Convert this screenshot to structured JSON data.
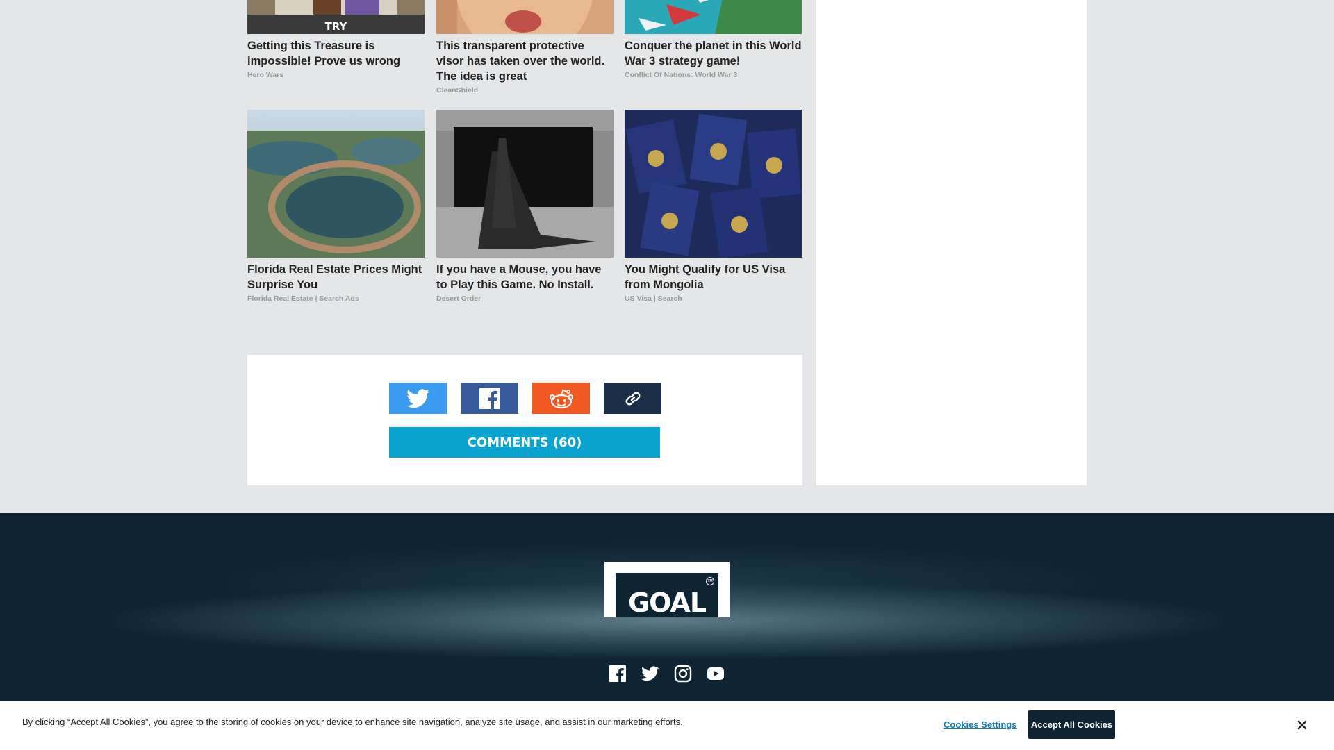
{
  "ads": [
    {
      "title": "Getting this Treasure is impossible! Prove us wrong",
      "source": "Hero Wars",
      "image": "game-castle-image",
      "badge": "TRY"
    },
    {
      "title": "This transparent protective visor has taken over the world. The idea is great",
      "source": "CleanShield",
      "image": "face-visor-image"
    },
    {
      "title": "Conquer the planet in this World War 3 strategy game!",
      "source": "Conflict Of Nations: World War 3",
      "image": "war-map-image"
    },
    {
      "title": "Florida Real Estate Prices Might Surprise You",
      "source": "Florida Real Estate | Search Ads",
      "image": "aerial-lake-homes-image"
    },
    {
      "title": "If you have a Mouse, you have to Play this Game. No Install.",
      "source": "Desert Order",
      "image": "jet-hangar-image"
    },
    {
      "title": "You Might Qualify for US Visa from Mongolia",
      "source": "US Visa | Search",
      "image": "passports-image"
    }
  ],
  "share": {
    "buttons": [
      {
        "name": "twitter",
        "color": "#3a9bf0"
      },
      {
        "name": "facebook",
        "color": "#375a9b"
      },
      {
        "name": "reddit",
        "color": "#f05a22"
      },
      {
        "name": "copy-link",
        "color": "#1c2f48"
      }
    ],
    "comments_label": "COMMENTS (60)"
  },
  "footer": {
    "logo_text": "GOAL",
    "logo_tm": "TM",
    "social": [
      "facebook-icon",
      "twitter-icon",
      "instagram-icon",
      "youtube-icon"
    ]
  },
  "cookie": {
    "text": "By clicking “Accept All Cookies”, you agree to the storing of cookies on your device to enhance site navigation, analyze site usage, and assist in our marketing efforts.",
    "settings_label": "Cookies Settings",
    "accept_label": "Accept All Cookies"
  }
}
